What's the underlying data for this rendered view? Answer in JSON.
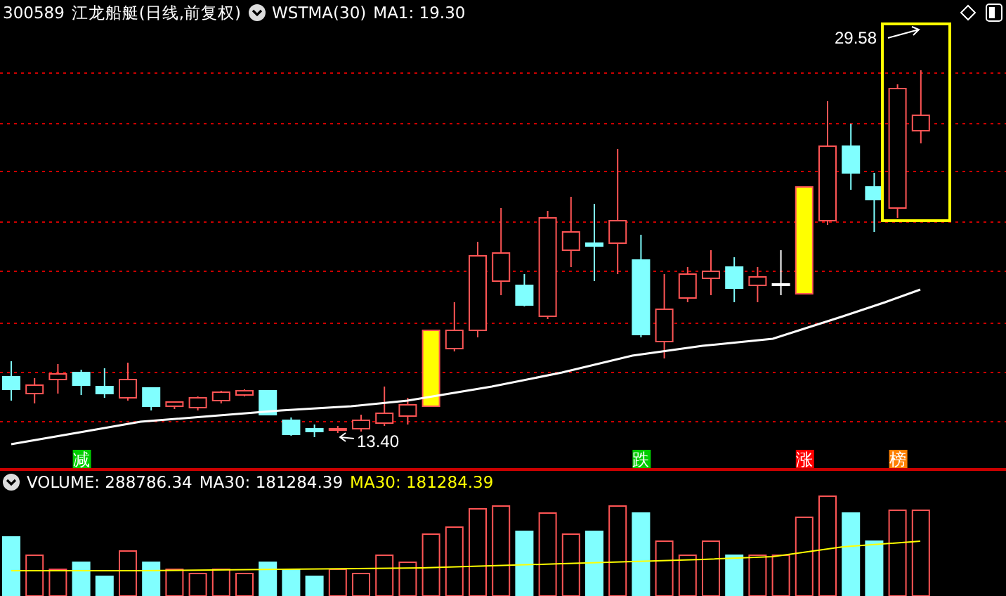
{
  "header": {
    "code": "300589",
    "name": "江龙船艇(日线,前复权)",
    "indicator": "WSTMA(30)",
    "ma_label": "MA1: 19.30"
  },
  "price_labels": [
    {
      "kind": "high",
      "text": "29.58"
    },
    {
      "kind": "low",
      "text": "13.40"
    }
  ],
  "signal_markers": [
    {
      "text": "减",
      "color": "#00cc00"
    },
    {
      "text": "跌",
      "color": "#00cc00"
    },
    {
      "text": "涨",
      "color": "#ff0000"
    },
    {
      "text": "榜",
      "color": "#ff8000"
    }
  ],
  "volume_header": {
    "volume": "VOLUME: 288786.34",
    "ma30": "MA30: 181284.39",
    "ma30_highlight": "MA30: 181284.39"
  }
}
